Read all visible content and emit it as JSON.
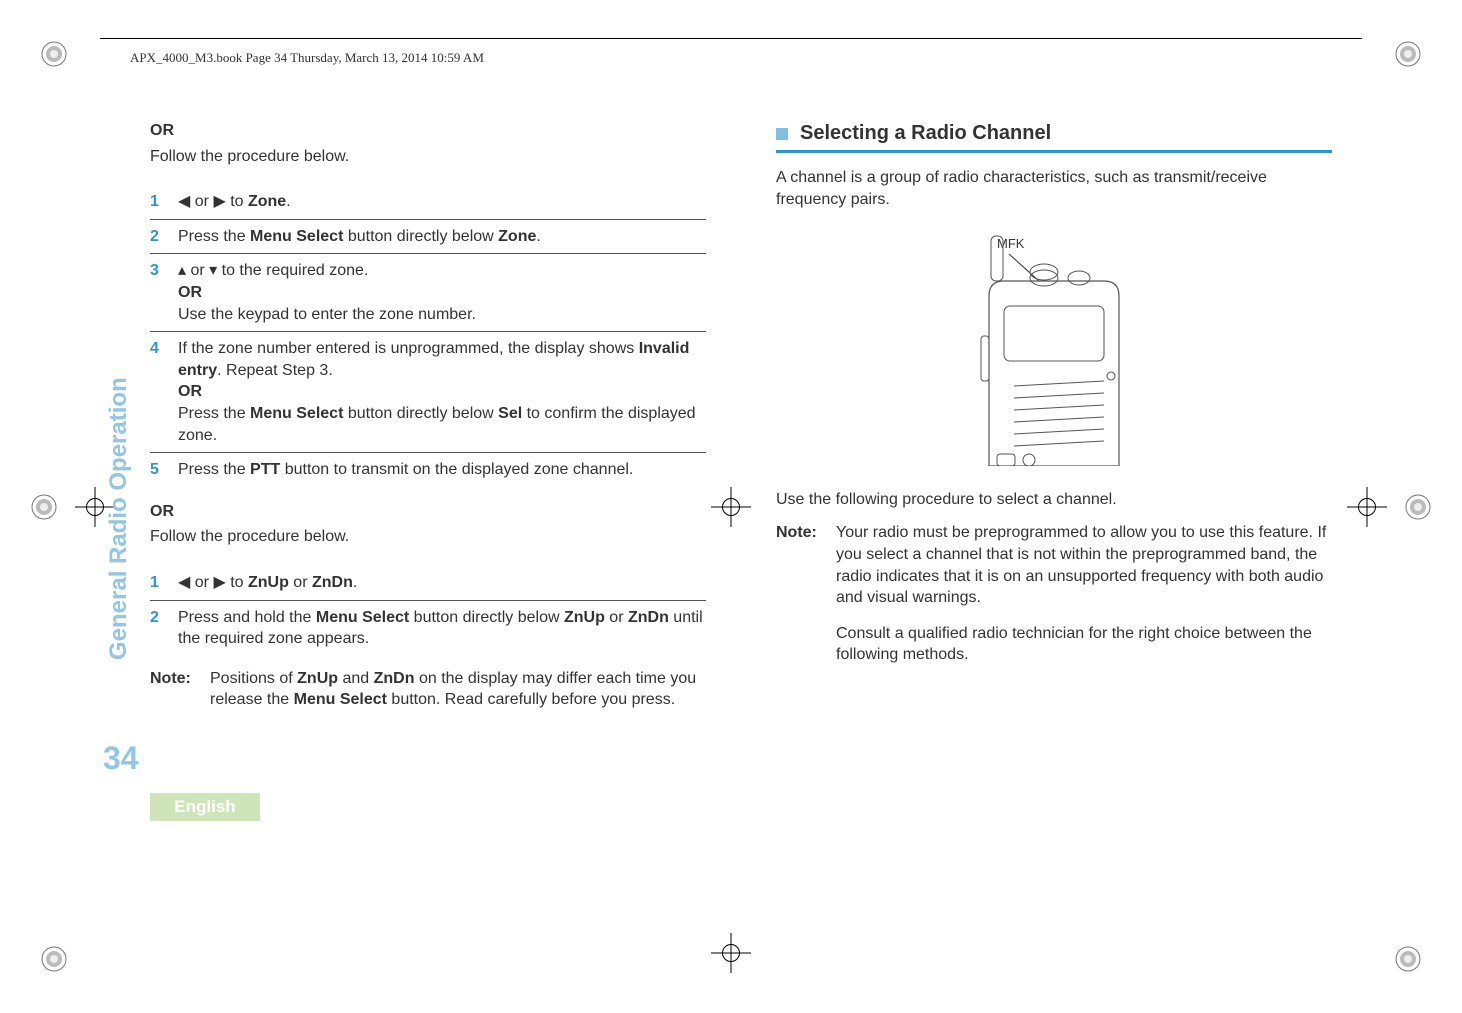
{
  "header_text": "APX_4000_M3.book  Page 34  Thursday, March 13, 2014  10:59 AM",
  "side_tab": "General Radio Operation",
  "page_number": "34",
  "language": "English",
  "left": {
    "or1": "OR",
    "follow1": "Follow the procedure below.",
    "steps1": {
      "s1": {
        "num": "1",
        "pre": "< or > to ",
        "zone": "Zone",
        "post": "."
      },
      "s2": {
        "num": "2",
        "pre": "Press the ",
        "bold": "Menu Select",
        "mid": " button directly below ",
        "zone": "Zone",
        "post": "."
      },
      "s3": {
        "num": "3",
        "line1": "U or D to the required zone.",
        "or": "OR",
        "line2": "Use the keypad to enter the zone number."
      },
      "s4": {
        "num": "4",
        "line1a": "If the zone number entered is unprogrammed, the display shows ",
        "invalid": "Invalid entry",
        "line1b": ". Repeat Step 3.",
        "or": "OR",
        "line2a": "Press the ",
        "bold": "Menu Select",
        "line2b": " button directly below ",
        "sel": "Sel",
        "line2c": " to confirm the displayed zone."
      },
      "s5": {
        "num": "5",
        "pre": "Press the ",
        "bold": "PTT",
        "post": " button to transmit on the displayed zone channel."
      }
    },
    "or2": "OR",
    "follow2": "Follow the procedure below.",
    "steps2": {
      "s1": {
        "num": "1",
        "pre": "< or > to ",
        "znup": "ZnUp",
        "or": " or ",
        "zndn": "ZnDn",
        "post": "."
      },
      "s2": {
        "num": "2",
        "pre": "Press and hold the ",
        "bold": "Menu Select",
        "mid": " button directly below ",
        "znup": "ZnUp",
        "or": " or ",
        "zndn": "ZnDn",
        "post": " until the required zone appears."
      }
    },
    "note": {
      "label": "Note:",
      "p1_a": "Positions of ",
      "znup": "ZnUp",
      "p1_b": " and ",
      "zndn": "ZnDn",
      "p1_c": " on the display may differ each time you release the ",
      "bold": "Menu Select",
      "p1_d": " button. Read carefully before you press."
    }
  },
  "right": {
    "heading": "Selecting a Radio Channel",
    "p1": "A channel is a group of radio characteristics, such as transmit/receive frequency pairs.",
    "mfk": "MFK",
    "p2": "Use the following procedure to select a channel.",
    "note": {
      "label": "Note:",
      "p1": "Your radio must be preprogrammed to allow you to use this feature. If you select a channel that is not within the preprogrammed band, the radio indicates that it is on an unsupported frequency with both audio and visual warnings.",
      "p2": "Consult a qualified radio technician for the right choice between the following methods."
    }
  }
}
